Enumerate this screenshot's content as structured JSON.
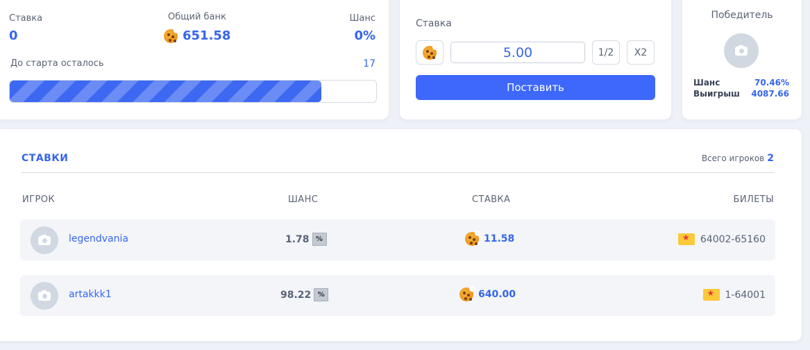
{
  "stats": {
    "bet_label": "Ставка",
    "bet_value": "0",
    "bank_label": "Общий банк",
    "bank_value": "651.58",
    "chance_label": "Шанс",
    "chance_value": "0%",
    "countdown_label": "До старта осталось",
    "countdown_value": "17",
    "progress_fraction": 0.85
  },
  "bet": {
    "label": "Ставка",
    "amount": "5.00",
    "half_label": "1/2",
    "double_label": "X2",
    "submit_label": "Поставить"
  },
  "winner": {
    "title": "Победитель",
    "chance_label": "Шанс",
    "chance_value": "70.46%",
    "win_label": "Выигрыш",
    "win_value": "4087.66"
  },
  "bets": {
    "title": "СТАВКИ",
    "total_label": "Всего игроков",
    "total_value": "2",
    "headers": {
      "player": "ИГРОК",
      "chance": "ШАНС",
      "stake": "СТАВКА",
      "tickets": "БИЛЕТЫ"
    },
    "pct_symbol": "%",
    "rows": [
      {
        "player": "legendvania",
        "chance": "1.78",
        "stake": "11.58",
        "tickets": "64002-65160"
      },
      {
        "player": "artakkk1",
        "chance": "98.22",
        "stake": "640.00",
        "tickets": "1-64001"
      }
    ]
  },
  "colors": {
    "accent": "#3565ee",
    "button": "#3d68fb",
    "background": "#eef1f7"
  }
}
